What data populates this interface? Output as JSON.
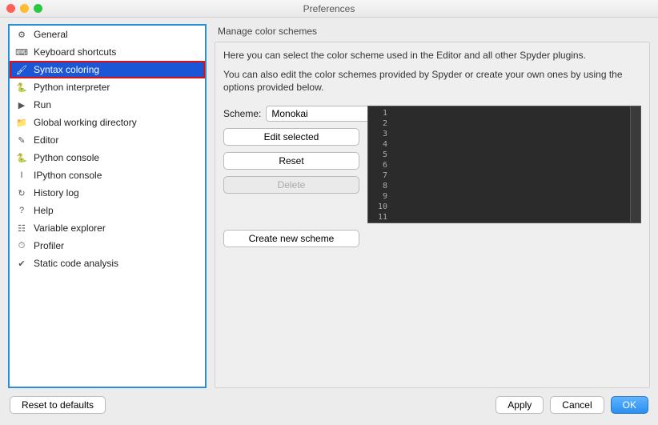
{
  "window": {
    "title": "Preferences"
  },
  "sidebar": {
    "items": [
      {
        "label": "General",
        "icon": "⚙"
      },
      {
        "label": "Keyboard shortcuts",
        "icon": "⌨"
      },
      {
        "label": "Syntax coloring",
        "icon": "🖌",
        "selected": true
      },
      {
        "label": "Python interpreter",
        "icon": "🐍"
      },
      {
        "label": "Run",
        "icon": "▶"
      },
      {
        "label": "Global working directory",
        "icon": "📁"
      },
      {
        "label": "Editor",
        "icon": "✎"
      },
      {
        "label": "Python console",
        "icon": "🐍"
      },
      {
        "label": "IPython console",
        "icon": "I"
      },
      {
        "label": "History log",
        "icon": "↻"
      },
      {
        "label": "Help",
        "icon": "?"
      },
      {
        "label": "Variable explorer",
        "icon": "☷"
      },
      {
        "label": "Profiler",
        "icon": "⏱"
      },
      {
        "label": "Static code analysis",
        "icon": "✔"
      }
    ]
  },
  "panel": {
    "group_title": "Manage color schemes",
    "intro1": "Here you can select the color scheme used in the Editor and all other Spyder plugins.",
    "intro2": "You can also edit the color schemes provided by Spyder or create your own ones by using the options provided below.",
    "scheme_label": "Scheme:",
    "scheme_value": "Monokai",
    "edit_btn": "Edit selected",
    "reset_btn": "Reset",
    "delete_btn": "Delete",
    "create_btn": "Create new scheme",
    "preview_lines": [
      "1",
      "2",
      "3",
      "4",
      "5",
      "6",
      "7",
      "8",
      "9",
      "10",
      "11"
    ]
  },
  "footer": {
    "reset": "Reset to defaults",
    "apply": "Apply",
    "cancel": "Cancel",
    "ok": "OK"
  }
}
